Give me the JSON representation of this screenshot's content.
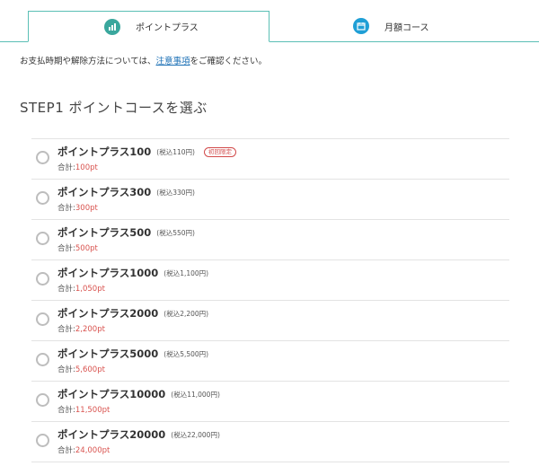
{
  "tabs": [
    {
      "label": "ポイントプラス",
      "icon": "chart-icon",
      "active": true
    },
    {
      "label": "月額コース",
      "icon": "calendar-icon",
      "active": false
    }
  ],
  "notice": {
    "before": "お支払時期や解除方法については、",
    "link": "注意事項",
    "after": "をご確認ください。"
  },
  "step_title": "STEP1 ポイントコースを選ぶ",
  "total_label": "合計:",
  "plans": [
    {
      "name": "ポイントプラス100",
      "tax": "(税込110円)",
      "badge": "初回限定",
      "total": "100pt"
    },
    {
      "name": "ポイントプラス300",
      "tax": "(税込330円)",
      "badge": "",
      "total": "300pt"
    },
    {
      "name": "ポイントプラス500",
      "tax": "(税込550円)",
      "badge": "",
      "total": "500pt"
    },
    {
      "name": "ポイントプラス1000",
      "tax": "(税込1,100円)",
      "badge": "",
      "total": "1,050pt"
    },
    {
      "name": "ポイントプラス2000",
      "tax": "(税込2,200円)",
      "badge": "",
      "total": "2,200pt"
    },
    {
      "name": "ポイントプラス5000",
      "tax": "(税込5,500円)",
      "badge": "",
      "total": "5,600pt"
    },
    {
      "name": "ポイントプラス10000",
      "tax": "(税込11,000円)",
      "badge": "",
      "total": "11,500pt"
    },
    {
      "name": "ポイントプラス20000",
      "tax": "(税込22,000円)",
      "badge": "",
      "total": "24,000pt"
    }
  ],
  "colors": {
    "accent_teal": "#5bbfb5",
    "price_red": "#d9534f",
    "link_blue": "#1a6fb5",
    "calendar_blue": "#1f9fd6"
  }
}
